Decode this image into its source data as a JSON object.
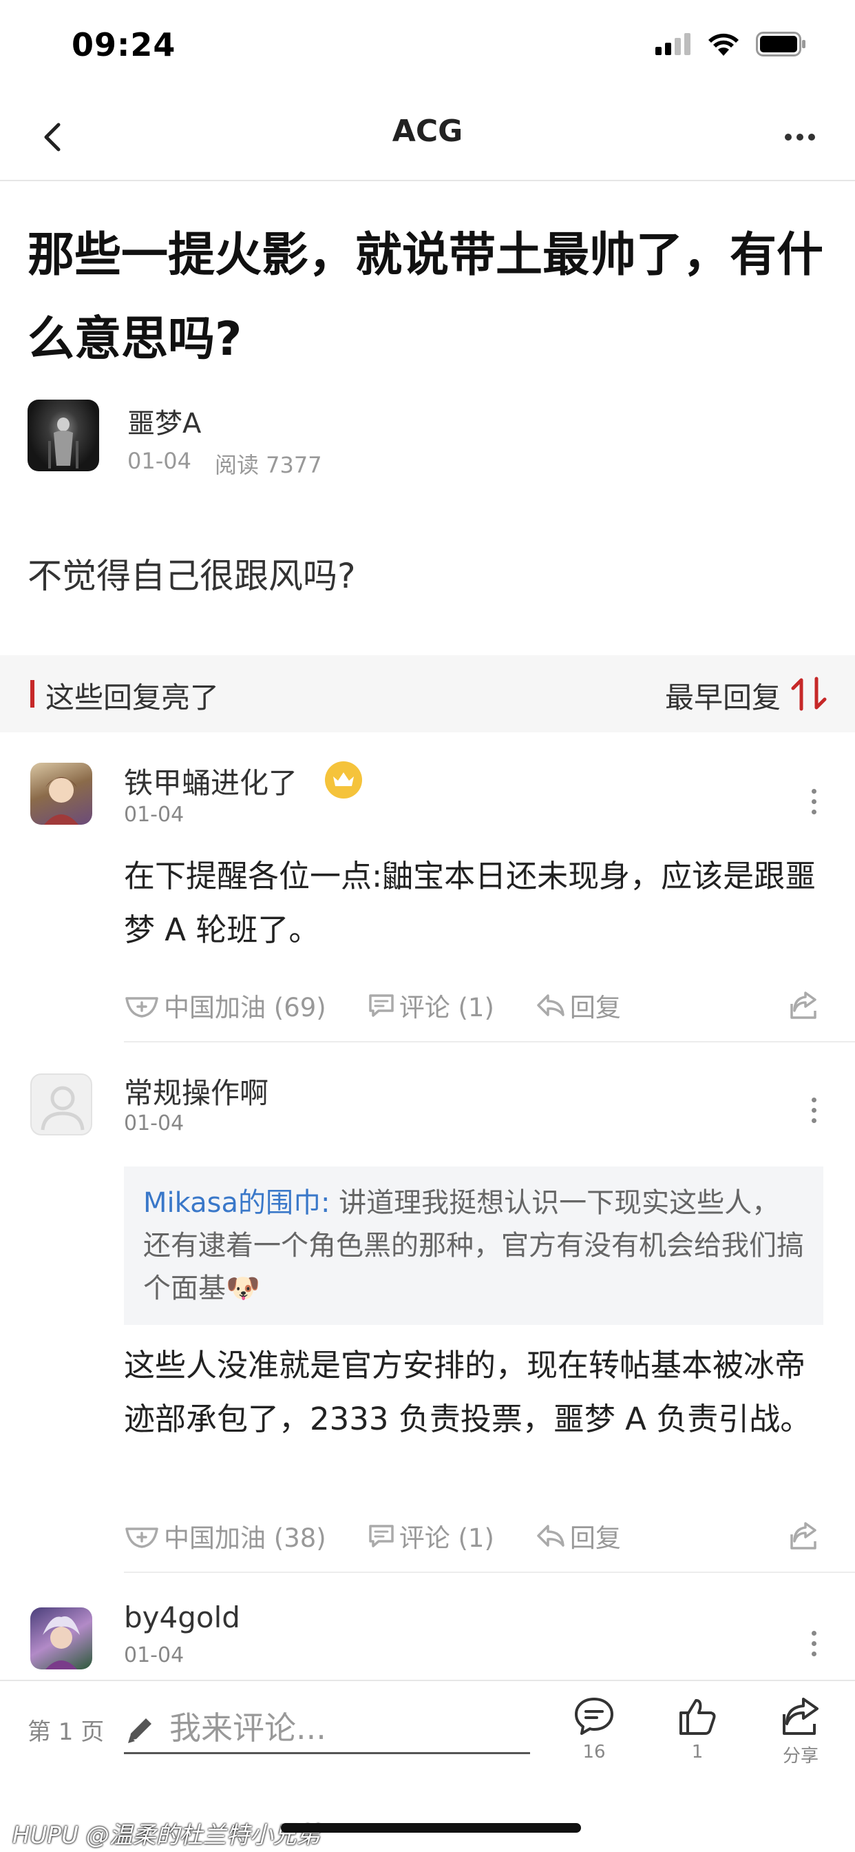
{
  "status": {
    "time": "09:24"
  },
  "nav": {
    "title": "ACG"
  },
  "post": {
    "title": "那些一提火影，就说带土最帅了，有什么意思吗?",
    "author": "噩梦A",
    "date": "01-04",
    "reads": "阅读 7377",
    "body": "不觉得自己很跟风吗?"
  },
  "section": {
    "title": "这些回复亮了",
    "sort_label": "最早回复"
  },
  "replies": [
    {
      "name": "铁甲蛹进化了",
      "date": "01-04",
      "text": "在下提醒各位一点:鼬宝本日还未现身，应该是跟噩梦 A 轮班了。",
      "like_label": "中国加油 (69)",
      "comment_label": "评论 (1)",
      "reply_label": "回复"
    },
    {
      "name": "常规操作啊",
      "date": "01-04",
      "quote_author": "Mikasa的围巾:",
      "quote_text": " 讲道理我挺想认识一下现实这些人，还有逮着一个角色黑的那种，官方有没有机会给我们搞个面基🐶",
      "text": "这些人没准就是官方安排的，现在转帖基本被冰帝迹部承包了，2333 负责投票，噩梦 A 负责引战。",
      "like_label": "中国加油 (38)",
      "comment_label": "评论 (1)",
      "reply_label": "回复"
    },
    {
      "name": "by4gold",
      "date": "01-04"
    }
  ],
  "bottom": {
    "page_label": "第 1 页",
    "comment_placeholder": "我来评论...",
    "comments_count": "16",
    "likes_count": "1",
    "share_label": "分享"
  },
  "watermark": "HUPU @温柔的杜兰特小兄弟",
  "colors": {
    "accent_red": "#c62828",
    "quote_link": "#3a78c9",
    "crown": "#f5c33b"
  }
}
